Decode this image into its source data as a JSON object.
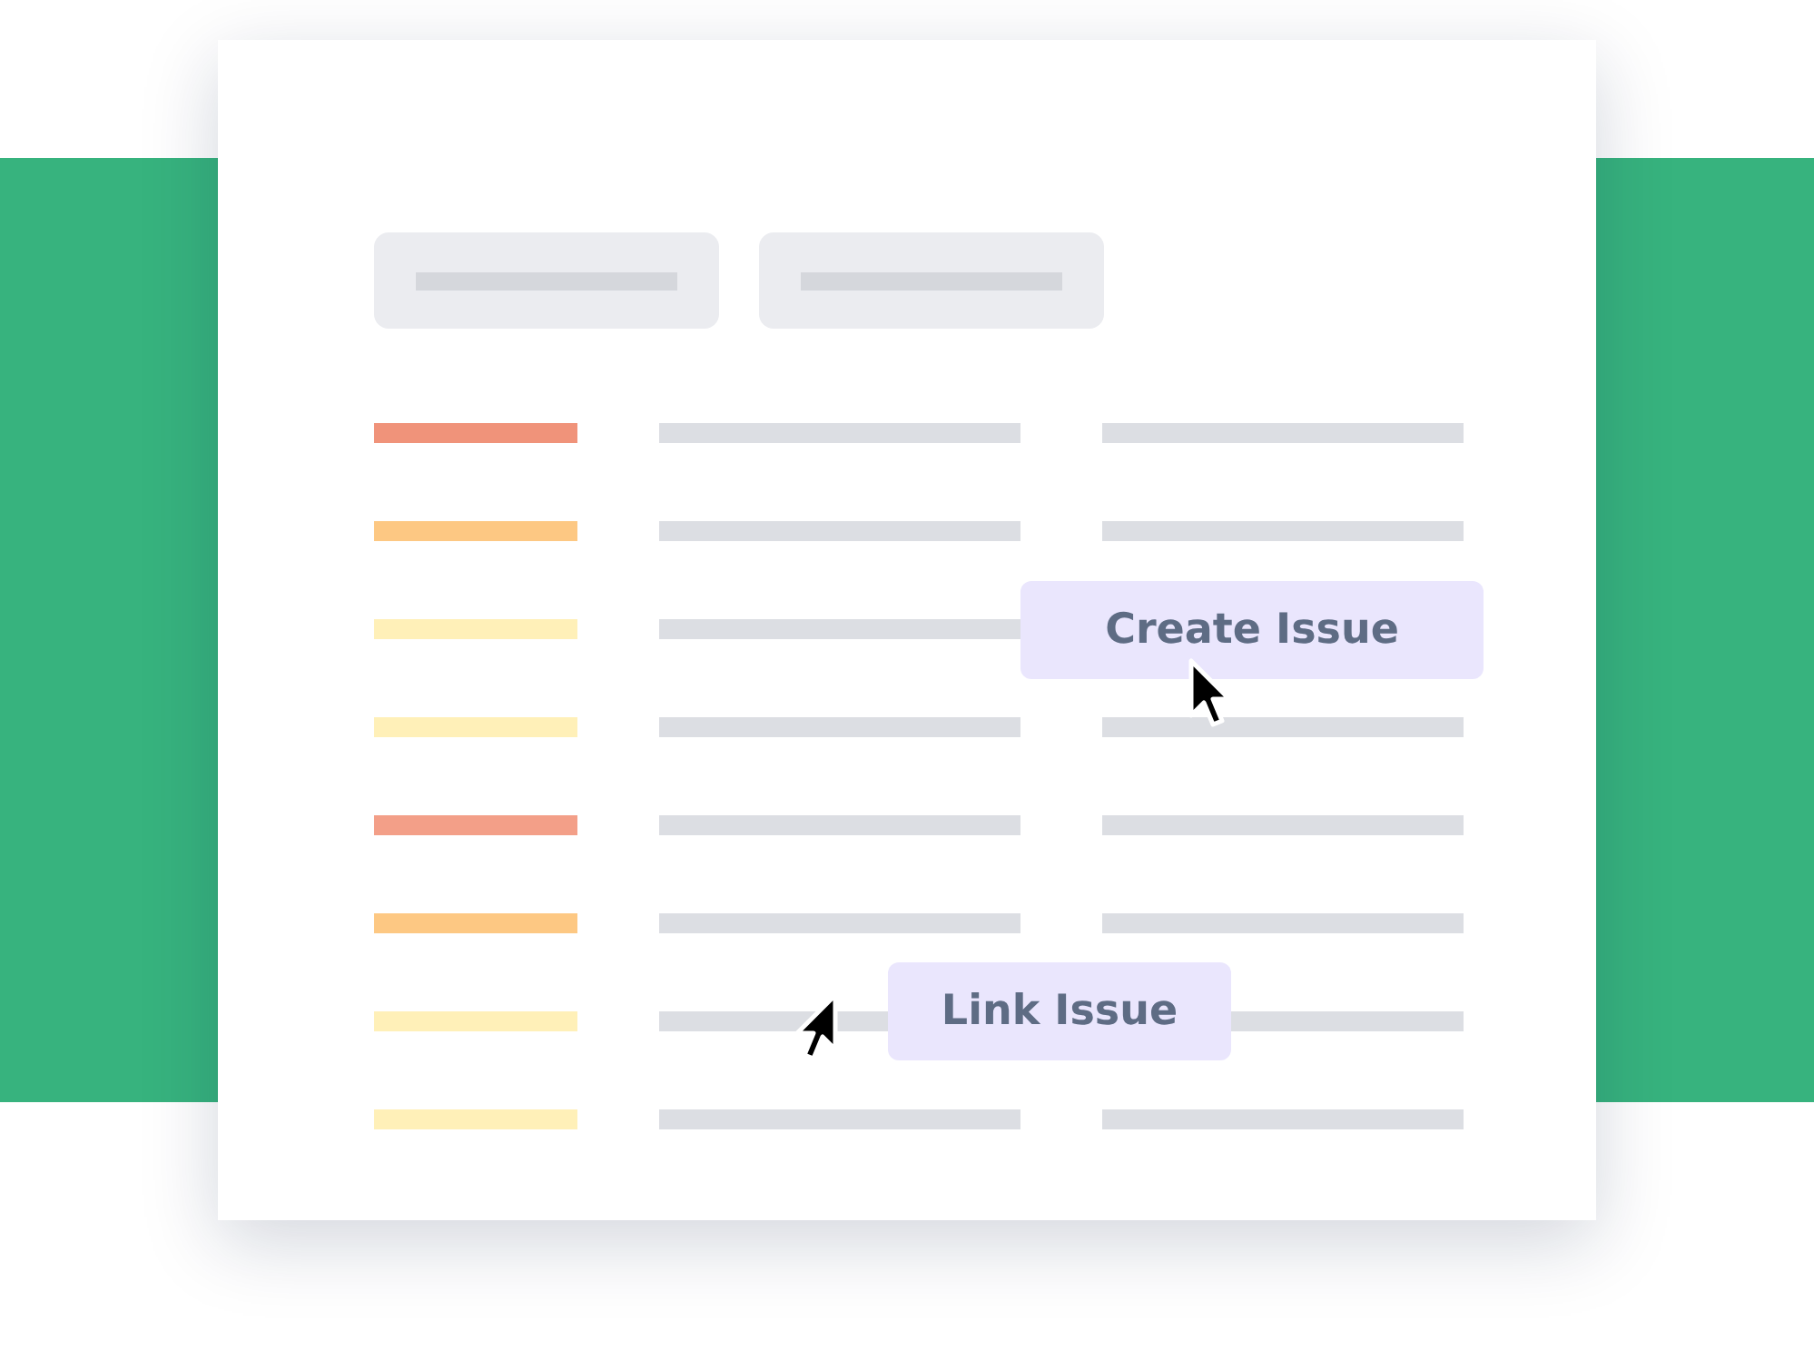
{
  "rows": [
    {
      "color": "#f0937a"
    },
    {
      "color": "#fdc883"
    },
    {
      "color": "#fff0b8"
    },
    {
      "color": "#fff0b8"
    },
    {
      "color": "#f39f88"
    },
    {
      "color": "#fdc883"
    },
    {
      "color": "#fff0b8"
    },
    {
      "color": "#fff0b8"
    }
  ],
  "actions": [
    {
      "label": "Create Issue"
    },
    {
      "label": "Link Issue"
    }
  ]
}
